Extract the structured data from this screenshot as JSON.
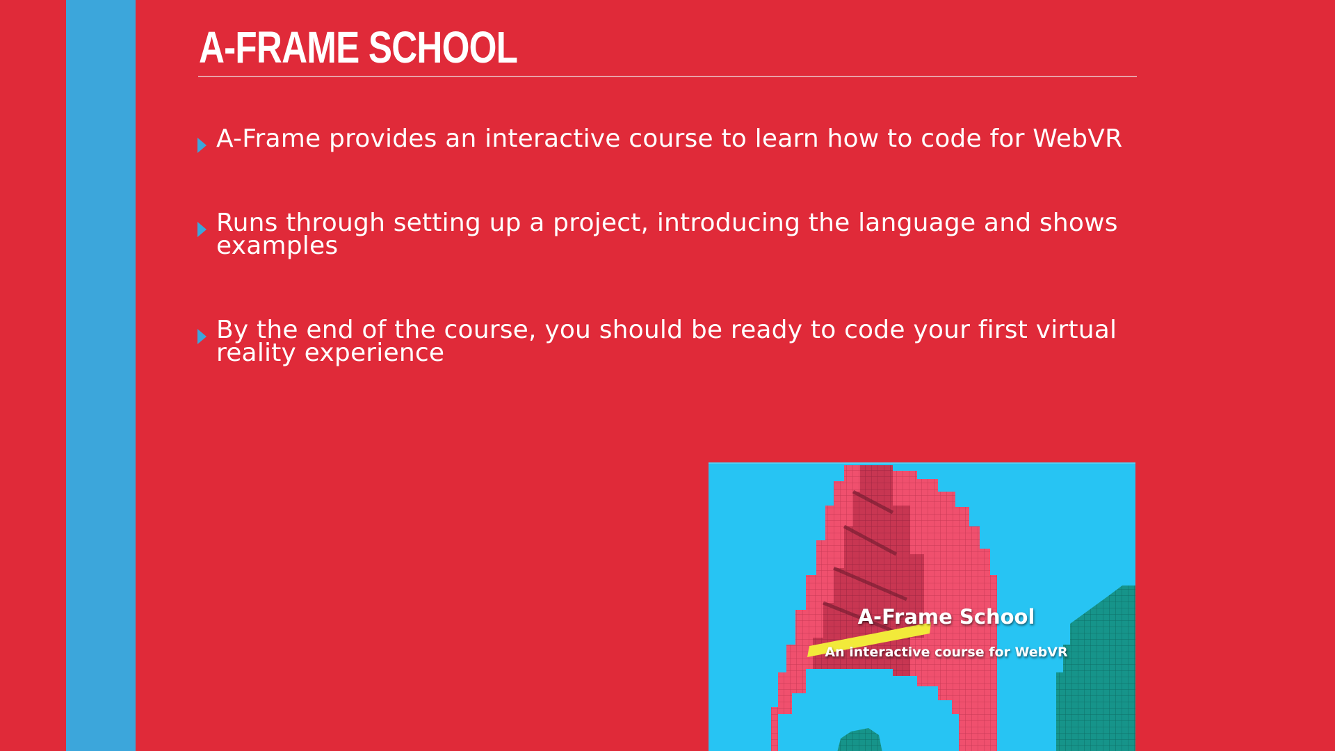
{
  "slide": {
    "title": "A-FRAME SCHOOL",
    "bullets": [
      {
        "text": "A-Frame provides an interactive course to learn how to code for WebVR"
      },
      {
        "text": "Runs through setting up a project, introducing the language and shows examples"
      },
      {
        "text": "By the end of the course, you should be ready to code your first virtual reality experience"
      }
    ]
  },
  "promo_image": {
    "title": "A-Frame School",
    "subtitle": "An interactive course for WebVR"
  },
  "colors": {
    "background": "#e02a39",
    "accent_stripe": "#3ca6db",
    "text": "#ffffff",
    "image_sky": "#27c4f3",
    "image_structure": "#f0506e",
    "image_teal": "#16948a",
    "image_highlight": "#f2ea3a"
  },
  "icons": [
    "bullet-arrow-icon"
  ]
}
